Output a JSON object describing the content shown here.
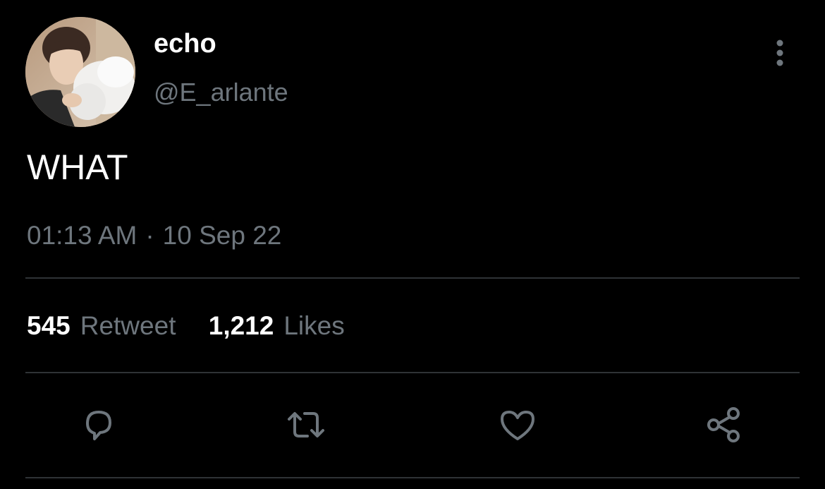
{
  "tweet": {
    "author": {
      "display_name": "echo",
      "handle": "@E_arlante"
    },
    "text": "WHAT",
    "timestamp": {
      "time": "01:13 AM",
      "separator": "·",
      "date": "10 Sep 22"
    },
    "stats": {
      "retweets": {
        "count": "545",
        "label": "Retweet"
      },
      "likes": {
        "count": "1,212",
        "label": "Likes"
      }
    },
    "actions": [
      "reply-icon",
      "retweet-icon",
      "heart-icon",
      "share-icon"
    ]
  },
  "colors": {
    "background": "#000000",
    "primary_text": "#ffffff",
    "secondary_text": "#6e767d",
    "divider": "#2f3336"
  }
}
